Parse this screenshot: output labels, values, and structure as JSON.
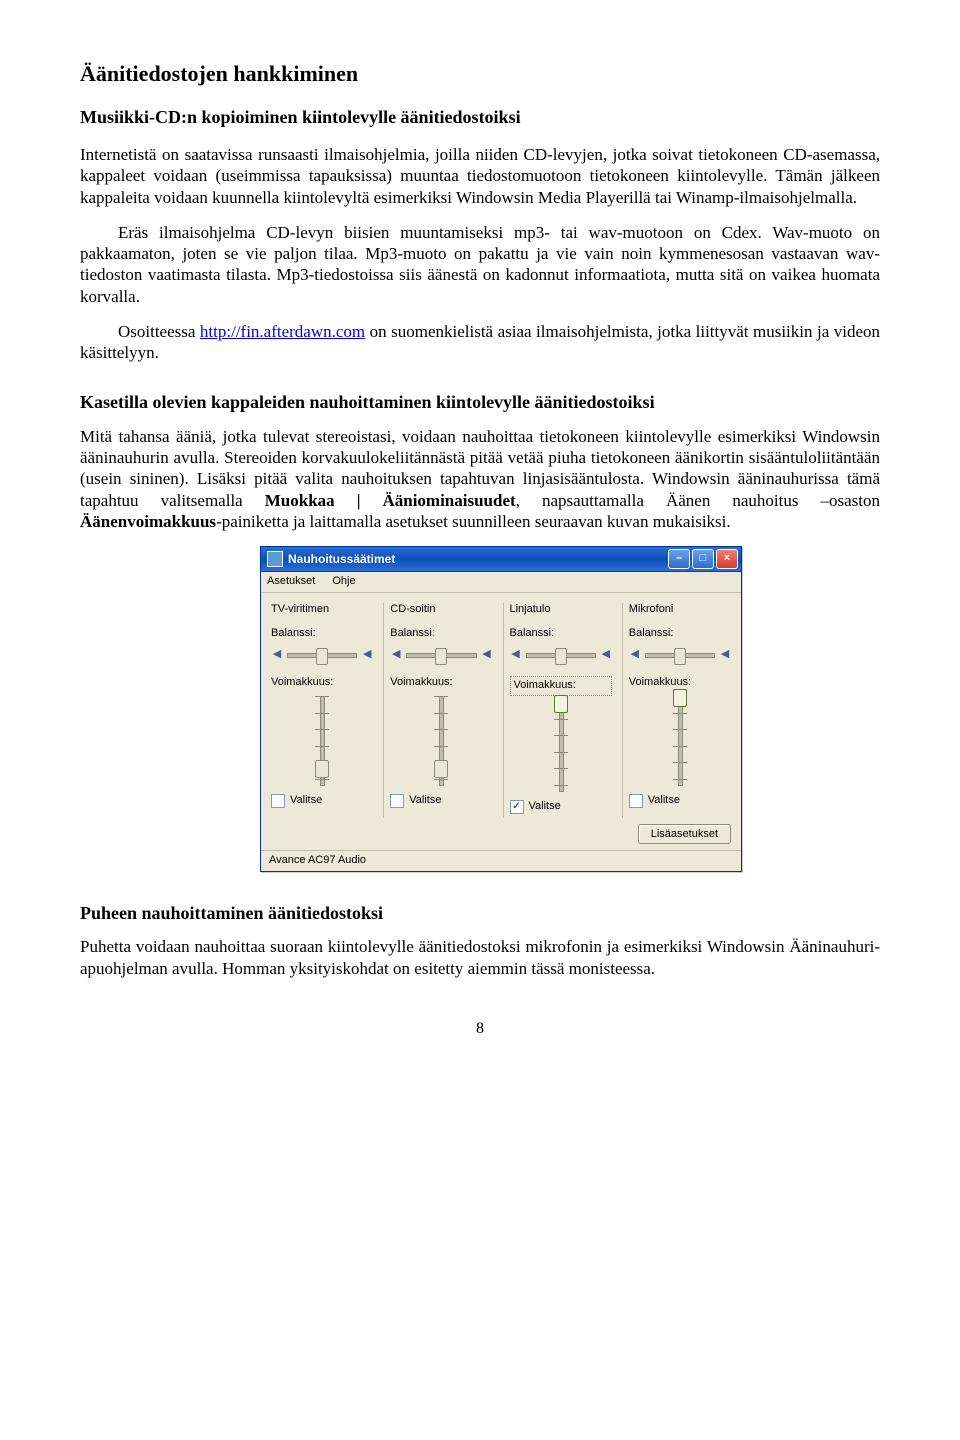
{
  "title": "Äänitiedostojen hankkiminen",
  "section1": {
    "heading": "Musiikki-CD:n kopioiminen kiintolevylle äänitiedostoiksi",
    "p1": "Internetistä on saatavissa runsaasti ilmaisohjelmia, joilla niiden CD-levyjen, jotka soivat tietokoneen CD-asemassa, kappaleet voidaan (useimmissa tapauksissa) muuntaa tiedostomuotoon tietokoneen kiintolevylle. Tämän jälkeen kappaleita voidaan kuunnella kiintolevyltä esimerkiksi Windowsin Media Playerillä tai Winamp-ilmaisohjelmalla.",
    "p2": "Eräs ilmaisohjelma CD-levyn biisien muuntamiseksi mp3- tai wav-muotoon on Cdex. Wav-muoto on pakkaamaton, joten se vie paljon tilaa. Mp3-muoto on pakattu ja vie vain noin kymmenesosan vastaavan wav-tiedoston vaatimasta tilasta. Mp3-tiedostoissa siis äänestä on kadonnut informaatiota, mutta sitä on vaikea huomata korvalla.",
    "p3_a": "Osoitteessa ",
    "p3_link": "http://fin.afterdawn.com",
    "p3_b": " on suomenkielistä asiaa ilmaisohjelmista, jotka liittyvät musiikin ja videon käsittelyyn."
  },
  "section2": {
    "heading": "Kasetilla olevien kappaleiden nauhoittaminen kiintolevylle äänitiedostoiksi",
    "p1_a": "Mitä tahansa ääniä, jotka tulevat stereoistasi, voidaan nauhoittaa tietokoneen kiintolevylle esimerkiksi Windowsin ääninauhurin avulla. Stereoiden korvakuulokeliitännästä pitää vetää piuha tietokoneen äänikortin sisääntuloliitäntään (usein sininen). Lisäksi pitää valita nauhoituksen tapahtuvan linjasisääntulosta. Windowsin ääninauhurissa tämä tapahtuu valitsemalla ",
    "p1_b": "Muokkaa | Ääniominaisuudet",
    "p1_c": ", napsauttamalla Äänen nauhoitus –osaston ",
    "p1_d": "Äänenvoimakkuus",
    "p1_e": "-painiketta ja laittamalla asetukset suunnilleen seuraavan kuvan mukaisiksi."
  },
  "dialog": {
    "title": "Nauhoitussäätimet",
    "menu": {
      "settings": "Asetukset",
      "help": "Ohje"
    },
    "labels": {
      "balance": "Balanssi:",
      "volume": "Voimakkuus:",
      "select": "Valitse"
    },
    "channels": [
      {
        "name": "TV-viritimen",
        "checked": false,
        "thumb_pct": 85
      },
      {
        "name": "CD-soitin",
        "checked": false,
        "thumb_pct": 85
      },
      {
        "name": "Linjatulo",
        "checked": true,
        "thumb_pct": 5
      },
      {
        "name": "Mikrofoni",
        "checked": false,
        "thumb_pct": 5
      }
    ],
    "button_advanced": "Lisäasetukset",
    "status": "Avance AC97 Audio"
  },
  "section3": {
    "heading": "Puheen nauhoittaminen äänitiedostoksi",
    "p1": "Puhetta voidaan nauhoittaa suoraan kiintolevylle äänitiedostoksi mikrofonin ja esimerkiksi Windowsin Ääninauhuri-apuohjelman avulla. Homman yksityiskohdat on esitetty aiemmin tässä monisteessa."
  },
  "page_number": "8"
}
